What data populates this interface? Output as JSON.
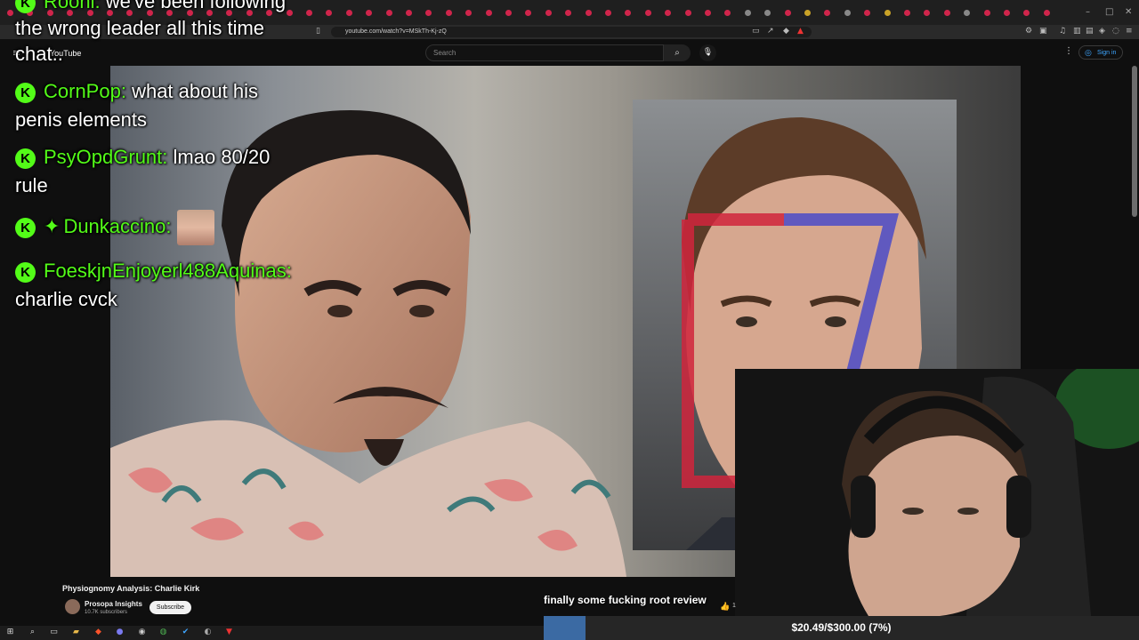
{
  "browser": {
    "url": "youtube.com/watch?v=MSkTh-Kj-zQ",
    "window_controls": [
      "–",
      "□",
      "✕"
    ]
  },
  "youtube": {
    "logo_text": "YouTube",
    "search_placeholder": "Search",
    "sign_in_label": "Sign in",
    "video_title": "Physiognomy Analysis: Charlie Kirk",
    "channel_name": "Prosopa Insights",
    "channel_subscribers": "10.7K subscribers",
    "subscribe_label": "Subscribe"
  },
  "chat": {
    "messages": [
      {
        "user": "Rooni:",
        "text": "we've been following"
      },
      {
        "user": "",
        "text": "the wrong leader all this time"
      },
      {
        "user": "",
        "text": "chat.."
      },
      {
        "user": "CornPop:",
        "text": "what about his"
      },
      {
        "user": "",
        "text": "penis elements"
      },
      {
        "user": "PsyOpdGrunt:",
        "text": "lmao 80/20"
      },
      {
        "user": "",
        "text": "rule"
      },
      {
        "user": "Dunkaccino:",
        "text": ""
      },
      {
        "user": "FoeskjnEnjoyerl488Aquinas:",
        "text": ""
      },
      {
        "user": "",
        "text": "charlie cvck"
      }
    ],
    "badge_letter": "K"
  },
  "stream": {
    "goal_message": "finally some fucking root review",
    "goal_label": "$20.49/$300.00 (7%)",
    "goal_progress": 0.07,
    "like_count": "1"
  },
  "colors": {
    "kick_green": "#53fc18",
    "goal_fill": "#3b6aa3",
    "overlay_red": "#d0243c",
    "overlay_blue": "#4b4bc8"
  }
}
